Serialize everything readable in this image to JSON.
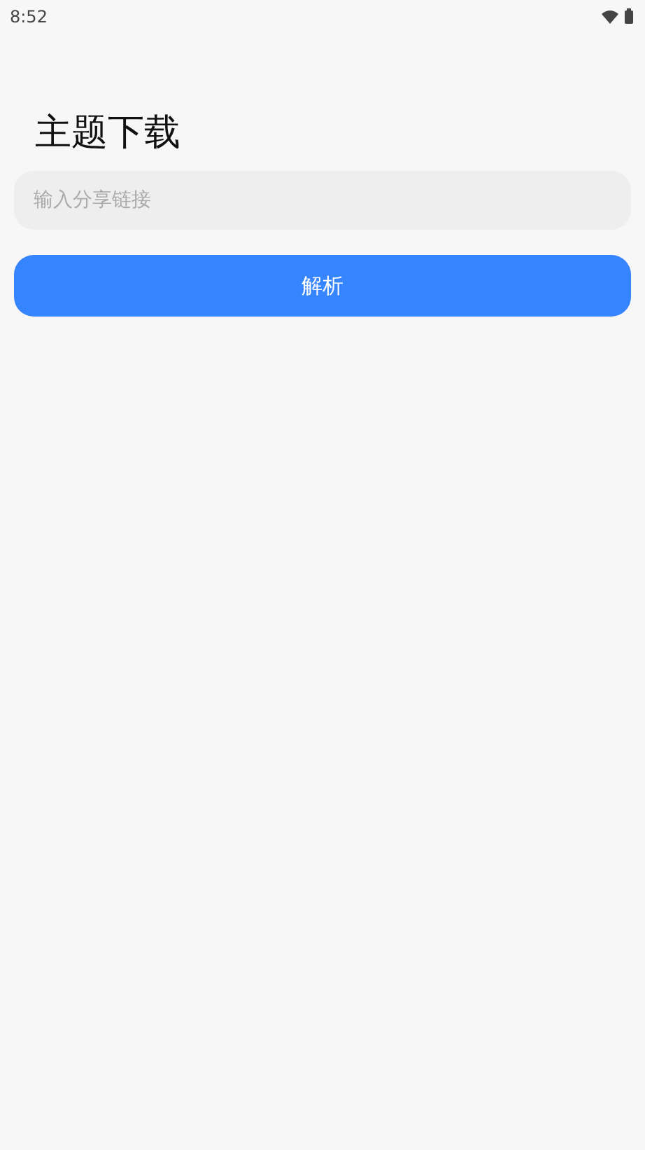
{
  "status_bar": {
    "time": "8:52"
  },
  "title": "主题下载",
  "link_field": {
    "placeholder": "输入分享链接"
  },
  "parse_button": {
    "label": "解析"
  }
}
